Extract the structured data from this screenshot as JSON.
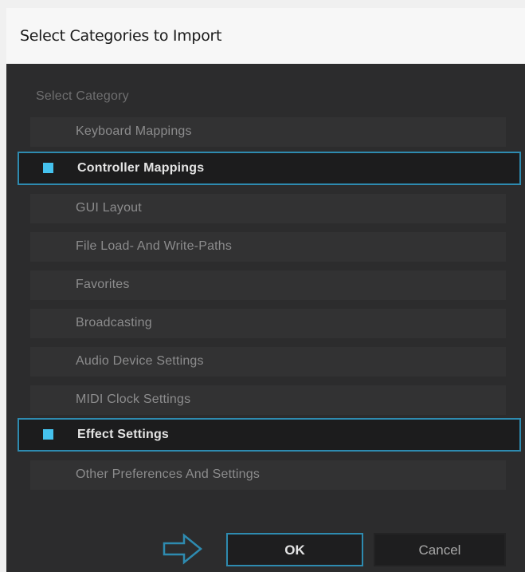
{
  "dialog": {
    "title": "Select Categories to Import",
    "section_label": "Select Category"
  },
  "categories": [
    {
      "label": "Keyboard Mappings",
      "selected": false
    },
    {
      "label": "Controller Mappings",
      "selected": true
    },
    {
      "label": "GUI Layout",
      "selected": false
    },
    {
      "label": "File Load- And Write-Paths",
      "selected": false
    },
    {
      "label": "Favorites",
      "selected": false
    },
    {
      "label": "Broadcasting",
      "selected": false
    },
    {
      "label": "Audio Device Settings",
      "selected": false
    },
    {
      "label": "MIDI Clock Settings",
      "selected": false
    },
    {
      "label": "Effect Settings",
      "selected": true
    },
    {
      "label": "Other Preferences And Settings",
      "selected": false
    }
  ],
  "buttons": {
    "ok_label": "OK",
    "cancel_label": "Cancel"
  },
  "colors": {
    "accent": "#2e8bb0",
    "check": "#45c2ee",
    "background": "#2c2c2d"
  },
  "icons": {
    "pointer": "arrow-right-outline-icon",
    "checked": "checkbox-filled-icon"
  }
}
